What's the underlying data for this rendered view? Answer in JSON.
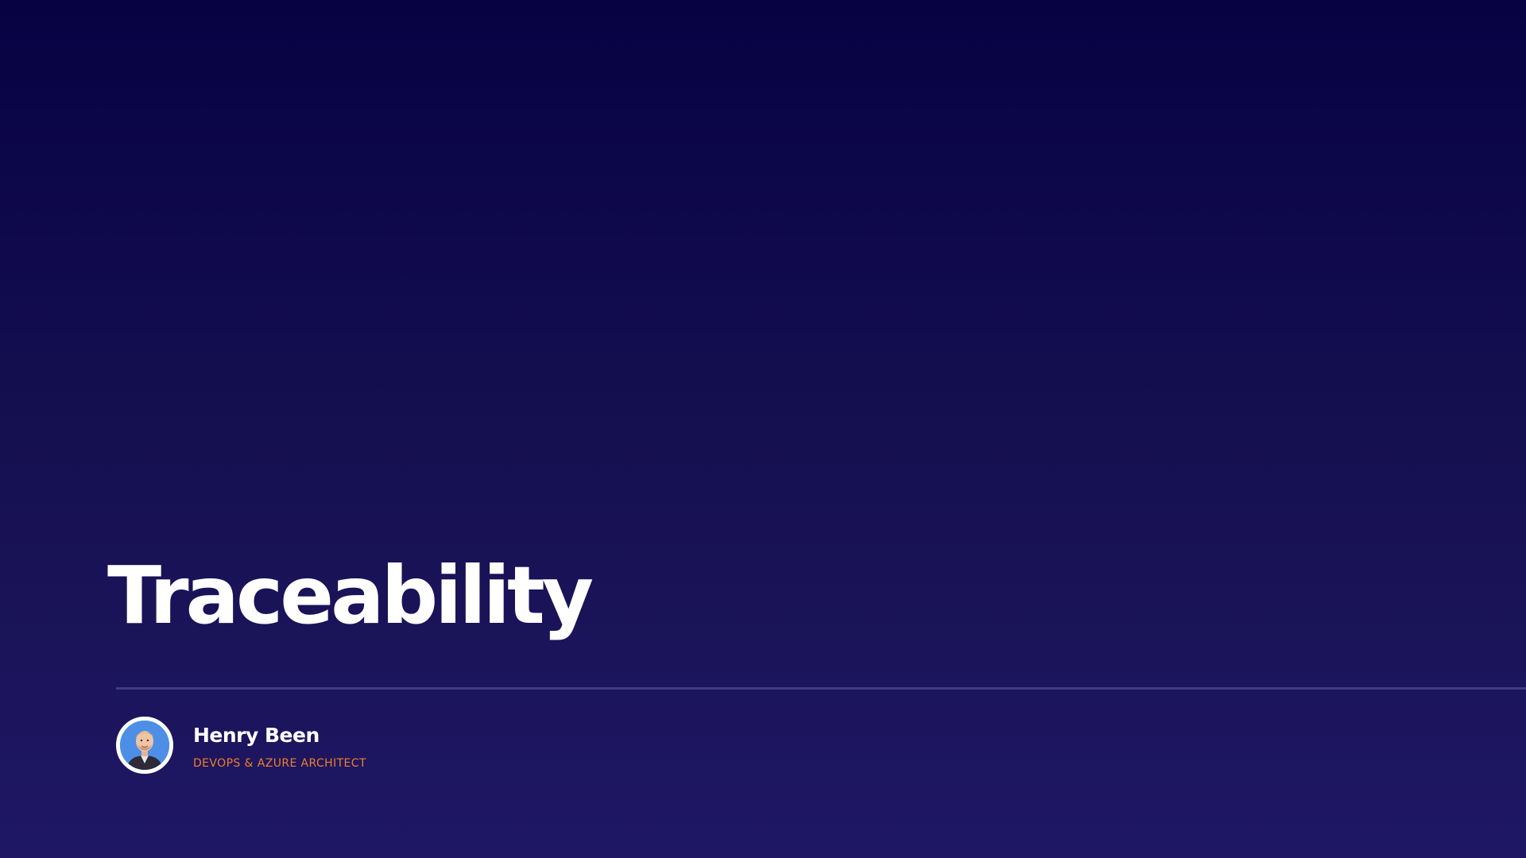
{
  "slide": {
    "title": "Traceability",
    "speaker": {
      "name": "Henry Been",
      "role": "DEVOPS & AZURE ARCHITECT",
      "avatar_icon": "person-photo-icon"
    }
  },
  "colors": {
    "background_top": "#070242",
    "background_bottom": "#1f1764",
    "title": "#ffffff",
    "divider": "#3f3c88",
    "role_accent": "#f07f2a",
    "avatar_background": "#4d8fe6"
  }
}
